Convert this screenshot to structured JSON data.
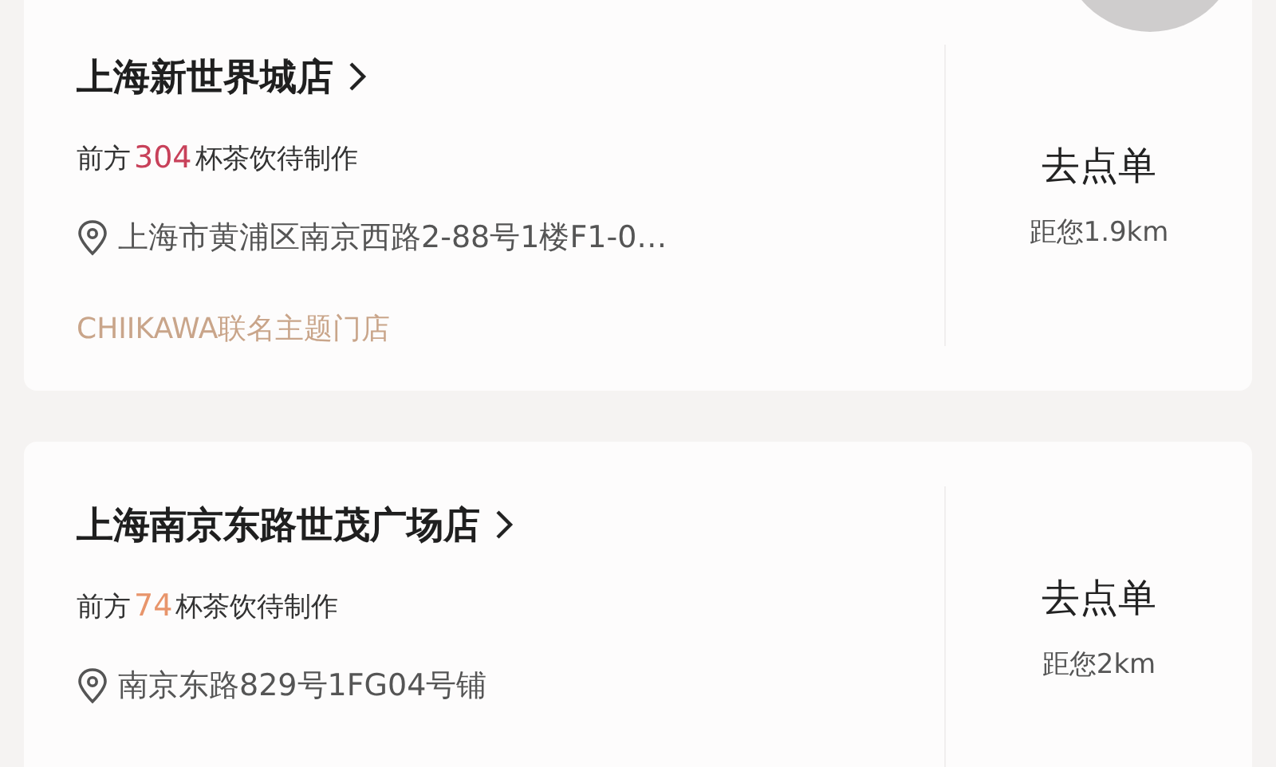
{
  "stores": [
    {
      "name": "上海新世界城店",
      "queue_prefix": "前方",
      "queue_count": "304",
      "queue_suffix": "杯茶饮待制作",
      "color": "#c8415a",
      "address": "上海市黄浦区南京西路2-88号1楼F1-0…",
      "tag": "CHIIKAWA联名主题门店",
      "action": "去点单",
      "distance": "距您1.9km"
    },
    {
      "name": "上海南京东路世茂广场店",
      "queue_prefix": "前方",
      "queue_count": "74",
      "queue_suffix": "杯茶饮待制作",
      "color": "#e8956b",
      "address": "南京东路829号1FG04号铺",
      "action": "去点单",
      "distance": "距您2km"
    }
  ]
}
